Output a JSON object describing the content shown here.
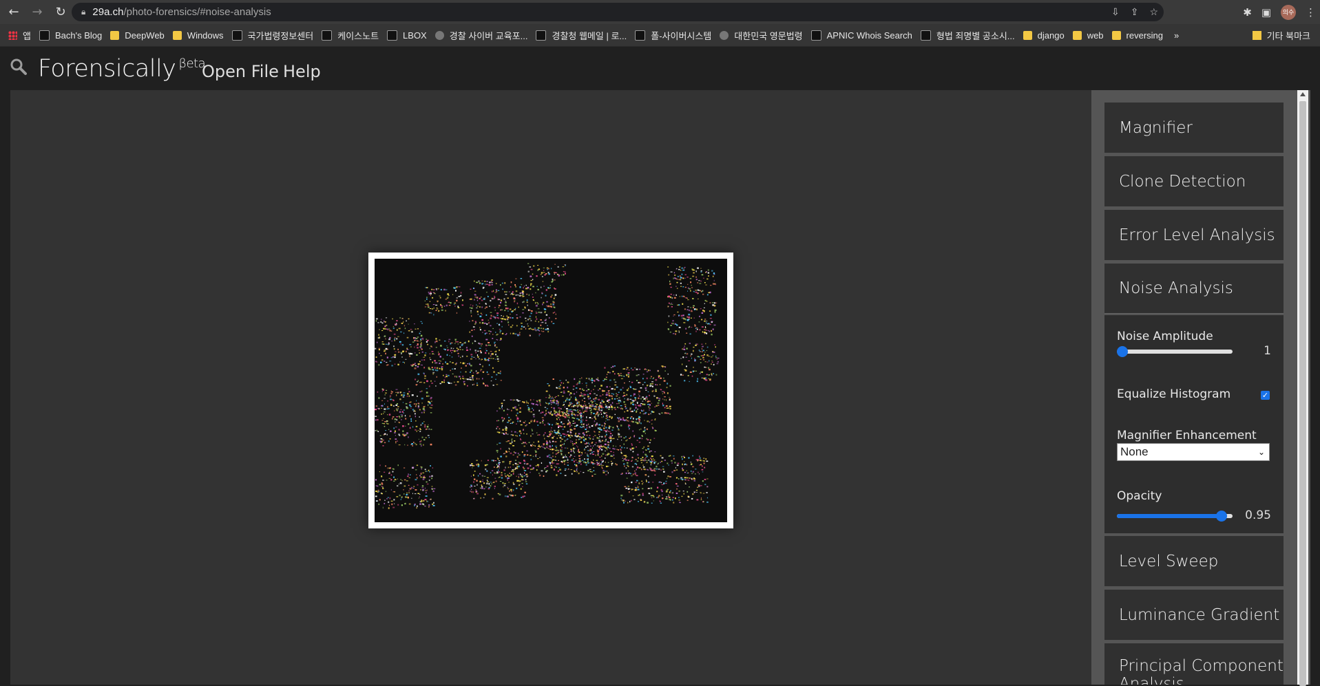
{
  "browser": {
    "url_host": "29a.ch",
    "url_path": "/photo-forensics/#noise-analysis",
    "avatar_text": "의수"
  },
  "bookmarks": [
    {
      "label": "앱",
      "icon": "apps-grid-icon"
    },
    {
      "label": "Bach's Blog",
      "icon": "site-icon"
    },
    {
      "label": "DeepWeb",
      "icon": "folder-icon"
    },
    {
      "label": "Windows",
      "icon": "folder-icon"
    },
    {
      "label": "국가법령정보센터",
      "icon": "site-icon"
    },
    {
      "label": "케이스노트",
      "icon": "site-icon"
    },
    {
      "label": "LBOX",
      "icon": "site-icon"
    },
    {
      "label": "경찰 사이버 교육포...",
      "icon": "globe-icon"
    },
    {
      "label": "경찰청 웹메일 | 로...",
      "icon": "site-icon"
    },
    {
      "label": "폴-사이버시스템",
      "icon": "site-icon"
    },
    {
      "label": "대한민국 영문법령",
      "icon": "globe-icon"
    },
    {
      "label": "APNIC Whois Search",
      "icon": "site-icon"
    },
    {
      "label": "형법 죄명별 공소시...",
      "icon": "site-icon"
    },
    {
      "label": "django",
      "icon": "folder-icon"
    },
    {
      "label": "web",
      "icon": "folder-icon"
    },
    {
      "label": "reversing",
      "icon": "folder-icon"
    }
  ],
  "bookmarks_more": "»",
  "bookmarks_other": "기타 북마크",
  "app": {
    "title": "Forensically",
    "title_sup": "βeta",
    "menu": {
      "open_file": "Open File",
      "help": "Help"
    }
  },
  "tools": [
    "Magnifier",
    "Clone Detection",
    "Error Level Analysis",
    "Noise Analysis",
    "Level Sweep",
    "Luminance Gradient",
    "Principal Component Analysis"
  ],
  "noise_panel": {
    "amplitude_label": "Noise Amplitude",
    "amplitude_value": "1",
    "amplitude_fraction": 0.0,
    "equalize_label": "Equalize Histogram",
    "equalize_checked": true,
    "enhancement_label": "Magnifier Enhancement",
    "enhancement_value": "None",
    "opacity_label": "Opacity",
    "opacity_value": "0.95",
    "opacity_fraction": 0.95
  },
  "colors": {
    "accent": "#1a73e8",
    "workspace": "#333333",
    "sidebar": "#555555",
    "tool_bg": "#303030"
  }
}
